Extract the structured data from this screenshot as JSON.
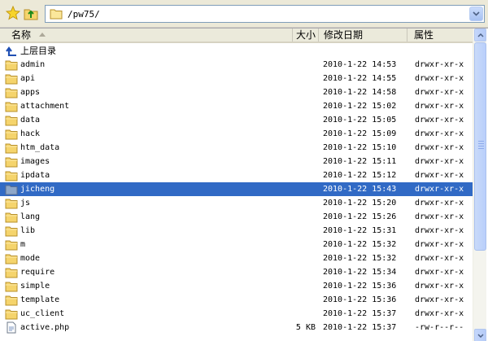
{
  "toolbar": {
    "address": "/pw75/"
  },
  "columns": {
    "name": "名称",
    "size": "大小",
    "date": "修改日期",
    "perm": "属性"
  },
  "parent": {
    "label": "上层目录"
  },
  "rows": [
    {
      "name": "admin",
      "size": "",
      "date": "2010-1-22 14:53",
      "perm": "drwxr-xr-x",
      "type": "folder"
    },
    {
      "name": "api",
      "size": "",
      "date": "2010-1-22 14:55",
      "perm": "drwxr-xr-x",
      "type": "folder"
    },
    {
      "name": "apps",
      "size": "",
      "date": "2010-1-22 14:58",
      "perm": "drwxr-xr-x",
      "type": "folder"
    },
    {
      "name": "attachment",
      "size": "",
      "date": "2010-1-22 15:02",
      "perm": "drwxr-xr-x",
      "type": "folder"
    },
    {
      "name": "data",
      "size": "",
      "date": "2010-1-22 15:05",
      "perm": "drwxr-xr-x",
      "type": "folder"
    },
    {
      "name": "hack",
      "size": "",
      "date": "2010-1-22 15:09",
      "perm": "drwxr-xr-x",
      "type": "folder"
    },
    {
      "name": "htm_data",
      "size": "",
      "date": "2010-1-22 15:10",
      "perm": "drwxr-xr-x",
      "type": "folder"
    },
    {
      "name": "images",
      "size": "",
      "date": "2010-1-22 15:11",
      "perm": "drwxr-xr-x",
      "type": "folder"
    },
    {
      "name": "ipdata",
      "size": "",
      "date": "2010-1-22 15:12",
      "perm": "drwxr-xr-x",
      "type": "folder"
    },
    {
      "name": "jicheng",
      "size": "",
      "date": "2010-1-22 15:43",
      "perm": "drwxr-xr-x",
      "type": "folder",
      "selected": true
    },
    {
      "name": "js",
      "size": "",
      "date": "2010-1-22 15:20",
      "perm": "drwxr-xr-x",
      "type": "folder"
    },
    {
      "name": "lang",
      "size": "",
      "date": "2010-1-22 15:26",
      "perm": "drwxr-xr-x",
      "type": "folder"
    },
    {
      "name": "lib",
      "size": "",
      "date": "2010-1-22 15:31",
      "perm": "drwxr-xr-x",
      "type": "folder"
    },
    {
      "name": "m",
      "size": "",
      "date": "2010-1-22 15:32",
      "perm": "drwxr-xr-x",
      "type": "folder"
    },
    {
      "name": "mode",
      "size": "",
      "date": "2010-1-22 15:32",
      "perm": "drwxr-xr-x",
      "type": "folder"
    },
    {
      "name": "require",
      "size": "",
      "date": "2010-1-22 15:34",
      "perm": "drwxr-xr-x",
      "type": "folder"
    },
    {
      "name": "simple",
      "size": "",
      "date": "2010-1-22 15:36",
      "perm": "drwxr-xr-x",
      "type": "folder"
    },
    {
      "name": "template",
      "size": "",
      "date": "2010-1-22 15:36",
      "perm": "drwxr-xr-x",
      "type": "folder"
    },
    {
      "name": "uc_client",
      "size": "",
      "date": "2010-1-22 15:37",
      "perm": "drwxr-xr-x",
      "type": "folder"
    },
    {
      "name": "active.php",
      "size": "5 KB",
      "date": "2010-1-22 15:37",
      "perm": "-rw-r--r--",
      "type": "file"
    }
  ],
  "colors": {
    "selection": "#316ac5",
    "folder": "#f5d46c"
  }
}
